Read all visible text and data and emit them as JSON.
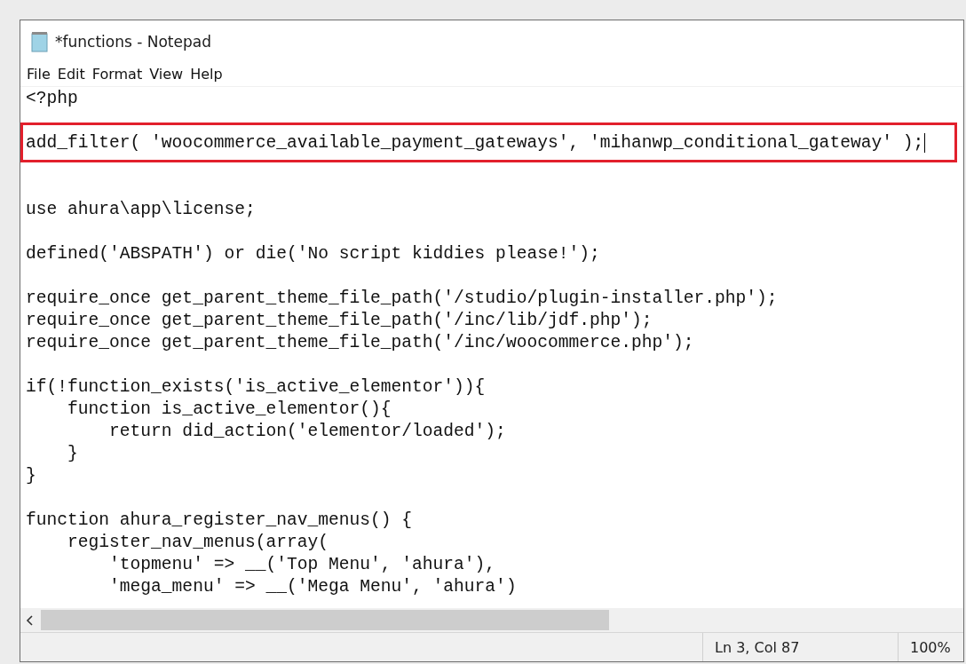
{
  "window": {
    "title": "*functions - Notepad"
  },
  "menu": [
    "File",
    "Edit",
    "Format",
    "View",
    "Help"
  ],
  "lines": [
    {
      "kind": "code",
      "text": "<?php",
      "highlighted": false,
      "caret": false
    },
    {
      "kind": "blank"
    },
    {
      "kind": "code",
      "text": "add_filter( 'woocommerce_available_payment_gateways', 'mihanwp_conditional_gateway' );",
      "highlighted": true,
      "caret": true
    },
    {
      "kind": "blank"
    },
    {
      "kind": "blank"
    },
    {
      "kind": "code",
      "text": "use ahura\\app\\license;",
      "highlighted": false,
      "caret": false
    },
    {
      "kind": "blank"
    },
    {
      "kind": "code",
      "text": "defined('ABSPATH') or die('No script kiddies please!');",
      "highlighted": false,
      "caret": false
    },
    {
      "kind": "blank"
    },
    {
      "kind": "code",
      "text": "require_once get_parent_theme_file_path('/studio/plugin-installer.php');",
      "highlighted": false,
      "caret": false
    },
    {
      "kind": "code",
      "text": "require_once get_parent_theme_file_path('/inc/lib/jdf.php');",
      "highlighted": false,
      "caret": false
    },
    {
      "kind": "code",
      "text": "require_once get_parent_theme_file_path('/inc/woocommerce.php');",
      "highlighted": false,
      "caret": false
    },
    {
      "kind": "blank"
    },
    {
      "kind": "code",
      "text": "if(!function_exists('is_active_elementor')){",
      "highlighted": false,
      "caret": false
    },
    {
      "kind": "code",
      "text": "    function is_active_elementor(){",
      "highlighted": false,
      "caret": false
    },
    {
      "kind": "code",
      "text": "        return did_action('elementor/loaded');",
      "highlighted": false,
      "caret": false
    },
    {
      "kind": "code",
      "text": "    }",
      "highlighted": false,
      "caret": false
    },
    {
      "kind": "code",
      "text": "}",
      "highlighted": false,
      "caret": false
    },
    {
      "kind": "blank"
    },
    {
      "kind": "code",
      "text": "function ahura_register_nav_menus() {",
      "highlighted": false,
      "caret": false
    },
    {
      "kind": "code",
      "text": "    register_nav_menus(array(",
      "highlighted": false,
      "caret": false
    },
    {
      "kind": "code",
      "text": "        'topmenu' => __('Top Menu', 'ahura'),",
      "highlighted": false,
      "caret": false
    },
    {
      "kind": "code",
      "text": "        'mega_menu' => __('Mega Menu', 'ahura')",
      "highlighted": false,
      "caret": false
    }
  ],
  "status_bar": {
    "position": "Ln 3, Col 87",
    "zoom": "100%"
  }
}
